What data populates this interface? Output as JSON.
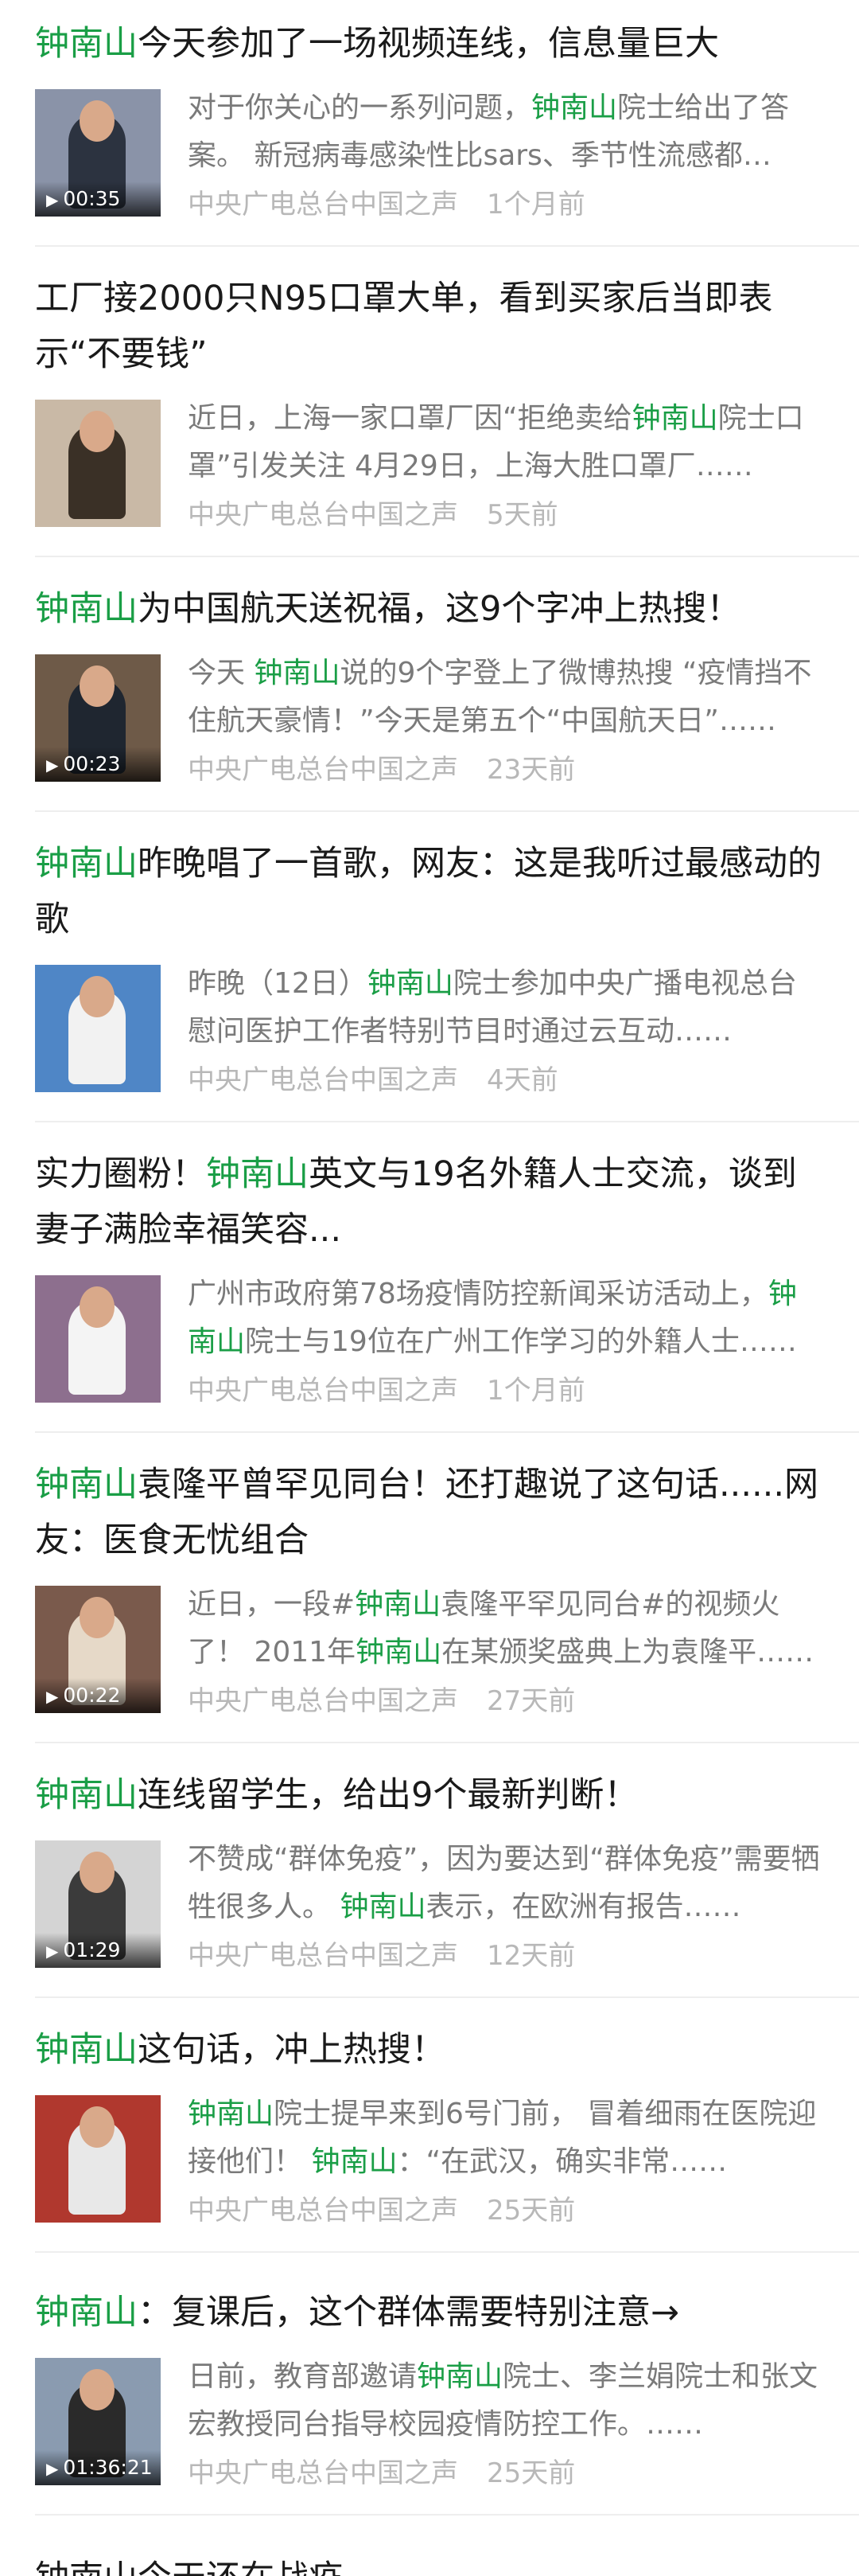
{
  "keyword": "钟南山",
  "colors": {
    "keyword": "#1a9e46",
    "title": "#1a1a1a",
    "desc": "#7a7a7a",
    "meta": "#b8b8b8"
  },
  "items": [
    {
      "title": [
        {
          "t": "钟南山",
          "kw": true
        },
        {
          "t": "今天参加了一场视频连线，信息量巨大"
        }
      ],
      "desc": [
        {
          "t": "对于你关心的一系列问题，"
        },
        {
          "t": "钟南山",
          "kw": true
        },
        {
          "t": "院士给出了答案。 新冠病毒感染性比sars、季节性流感都强……"
        }
      ],
      "source": "中央广电总台中国之声",
      "time": "1个月前",
      "duration": "00:35",
      "thumb": {
        "bg": "#8a93a8",
        "fg": "#2c3340"
      }
    },
    {
      "title": [
        {
          "t": "工厂接2000只N95口罩大单，看到买家后当即表示“不要钱”"
        }
      ],
      "desc": [
        {
          "t": "近日，上海一家口罩厂因“拒绝卖给"
        },
        {
          "t": "钟南山",
          "kw": true
        },
        {
          "t": "院士口罩”引发关注 4月29日，上海大胜口罩厂……"
        }
      ],
      "source": "中央广电总台中国之声",
      "time": "5天前",
      "duration": "",
      "thumb": {
        "bg": "#c9b9a6",
        "fg": "#3a3026"
      }
    },
    {
      "title": [
        {
          "t": "钟南山",
          "kw": true
        },
        {
          "t": "为中国航天送祝福，这9个字冲上热搜！"
        }
      ],
      "desc": [
        {
          "t": "今天 "
        },
        {
          "t": "钟南山",
          "kw": true
        },
        {
          "t": "说的9个字登上了微博热搜 “疫情挡不住航天豪情！”今天是第五个“中国航天日”……"
        }
      ],
      "source": "中央广电总台中国之声",
      "time": "23天前",
      "duration": "00:23",
      "thumb": {
        "bg": "#6e5a48",
        "fg": "#1f2630"
      }
    },
    {
      "title": [
        {
          "t": "钟南山",
          "kw": true
        },
        {
          "t": "昨晚唱了一首歌，网友：这是我听过最感动的歌"
        }
      ],
      "desc": [
        {
          "t": "昨晚（12日）"
        },
        {
          "t": "钟南山",
          "kw": true
        },
        {
          "t": "院士参加中央广播电视总台慰问医护工作者特别节目时通过云互动……"
        }
      ],
      "source": "中央广电总台中国之声",
      "time": "4天前",
      "duration": "",
      "thumb": {
        "bg": "#4f86c6",
        "fg": "#f2f2f2"
      }
    },
    {
      "title": [
        {
          "t": "实力圈粉！"
        },
        {
          "t": "钟南山",
          "kw": true
        },
        {
          "t": "英文与19名外籍人士交流，谈到妻子满脸幸福笑容..."
        }
      ],
      "desc": [
        {
          "t": "广州市政府第78场疫情防控新闻采访活动上，"
        },
        {
          "t": "钟南山",
          "kw": true
        },
        {
          "t": "院士与19位在广州工作学习的外籍人士……"
        }
      ],
      "source": "中央广电总台中国之声",
      "time": "1个月前",
      "duration": "",
      "thumb": {
        "bg": "#8d6f8e",
        "fg": "#f4f4f4"
      }
    },
    {
      "title": [
        {
          "t": "钟南山",
          "kw": true
        },
        {
          "t": "袁隆平曾罕见同台！还打趣说了这句话......网友：医食无忧组合"
        }
      ],
      "desc": [
        {
          "t": "近日，一段#"
        },
        {
          "t": "钟南山",
          "kw": true
        },
        {
          "t": "袁隆平罕见同台#的视频火了！ 2011年"
        },
        {
          "t": "钟南山",
          "kw": true
        },
        {
          "t": "在某颁奖盛典上为袁隆平……"
        }
      ],
      "source": "中央广电总台中国之声",
      "time": "27天前",
      "duration": "00:22",
      "thumb": {
        "bg": "#7a5a4c",
        "fg": "#e6d9c8"
      }
    },
    {
      "title": [
        {
          "t": "钟南山",
          "kw": true
        },
        {
          "t": "连线留学生，给出9个最新判断！"
        }
      ],
      "desc": [
        {
          "t": "不赞成“群体免疫”，因为要达到“群体免疫”需要牺牲很多人。 "
        },
        {
          "t": "钟南山",
          "kw": true
        },
        {
          "t": "表示，在欧洲有报告……"
        }
      ],
      "source": "中央广电总台中国之声",
      "time": "12天前",
      "duration": "01:29",
      "thumb": {
        "bg": "#d4d4d4",
        "fg": "#3b3b3b"
      }
    },
    {
      "title": [
        {
          "t": "钟南山",
          "kw": true
        },
        {
          "t": "这句话，冲上热搜！"
        }
      ],
      "desc": [
        {
          "t": "钟南山",
          "kw": true
        },
        {
          "t": "院士提早来到6号门前， 冒着细雨在医院迎接他们！ "
        },
        {
          "t": "钟南山",
          "kw": true
        },
        {
          "t": "：“在武汉，确实非常……"
        }
      ],
      "source": "中央广电总台中国之声",
      "time": "25天前",
      "duration": "",
      "thumb": {
        "bg": "#b0382e",
        "fg": "#e8e8e8"
      }
    },
    {
      "title": [
        {
          "t": "钟南山",
          "kw": true
        },
        {
          "t": "：复课后，这个群体需要特别注意→"
        }
      ],
      "desc": [
        {
          "t": "日前，教育部邀请"
        },
        {
          "t": "钟南山",
          "kw": true
        },
        {
          "t": "院士、李兰娟院士和张文宏教授同台指导校园疫情防控工作。……"
        }
      ],
      "source": "中央广电总台中国之声",
      "time": "25天前",
      "duration": "01:36:21",
      "thumb": {
        "bg": "#8a9bb0",
        "fg": "#2a2a2a"
      }
    }
  ],
  "partial_title": "钟南山今天还在战疫……"
}
